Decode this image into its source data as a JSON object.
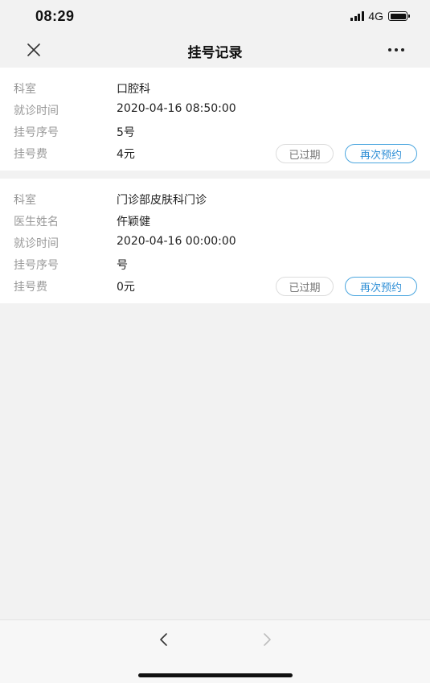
{
  "status_bar": {
    "time": "08:29",
    "network": "4G",
    "icons": [
      "signal-icon",
      "battery-icon"
    ]
  },
  "nav": {
    "title": "挂号记录",
    "close_icon": "close-icon",
    "more_icon": "more-icon"
  },
  "records": [
    {
      "rows": [
        {
          "label": "科室",
          "value": "口腔科"
        },
        {
          "label": "就诊时间",
          "value": "2020-04-16 08:50:00"
        },
        {
          "label": "挂号序号",
          "value": "5号"
        },
        {
          "label": "挂号费",
          "value": "4元"
        }
      ],
      "status_label": "已过期",
      "action_label": "再次预约"
    },
    {
      "rows": [
        {
          "label": "科室",
          "value": "门诊部皮肤科门诊"
        },
        {
          "label": "医生姓名",
          "value": "仵颖健"
        },
        {
          "label": "就诊时间",
          "value": "2020-04-16 00:00:00"
        },
        {
          "label": "挂号序号",
          "value": "号"
        },
        {
          "label": "挂号费",
          "value": "0元"
        }
      ],
      "status_label": "已过期",
      "action_label": "再次预约"
    }
  ],
  "colors": {
    "accent": "#2f8fd6",
    "label_gray": "#999999",
    "page_background": "#f2f2f2"
  },
  "toolbar": {
    "back_icon": "chevron-left-icon",
    "forward_icon": "chevron-right-icon"
  }
}
